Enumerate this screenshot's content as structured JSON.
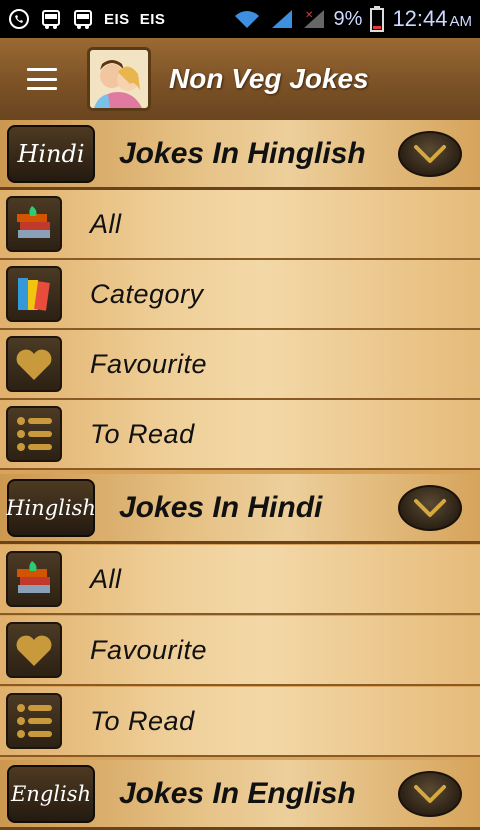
{
  "status_bar": {
    "carrier_1": "EIS",
    "carrier_2": "EIS",
    "battery_percent": "9%",
    "time": "12:44",
    "ampm": "AM",
    "icons": [
      "whatsapp-icon",
      "bus-icon",
      "bus-icon",
      "wifi-icon",
      "signal-icon",
      "signal-no-sim-icon",
      "battery-icon"
    ]
  },
  "app_bar": {
    "title": "Non Veg Jokes",
    "menu_icon": "hamburger-icon",
    "logo_icon": "app-logo-icon"
  },
  "sections": [
    {
      "badge": "Hindi",
      "title": "Jokes In Hinglish",
      "items": [
        {
          "label": "All",
          "icon": "books-icon"
        },
        {
          "label": "Category",
          "icon": "category-books-icon"
        },
        {
          "label": "Favourite",
          "icon": "heart-icon"
        },
        {
          "label": "To Read",
          "icon": "list-icon"
        }
      ]
    },
    {
      "badge": "Hinglish",
      "title": "Jokes In Hindi",
      "items": [
        {
          "label": "All",
          "icon": "books-icon"
        },
        {
          "label": "Favourite",
          "icon": "heart-icon"
        },
        {
          "label": "To Read",
          "icon": "list-icon"
        }
      ]
    },
    {
      "badge": "English",
      "title": "Jokes In English",
      "items": []
    }
  ],
  "colors": {
    "row_bg": "#efcf98",
    "appbar_bg": "#7c5226",
    "icon_gold": "#c99a3c"
  }
}
